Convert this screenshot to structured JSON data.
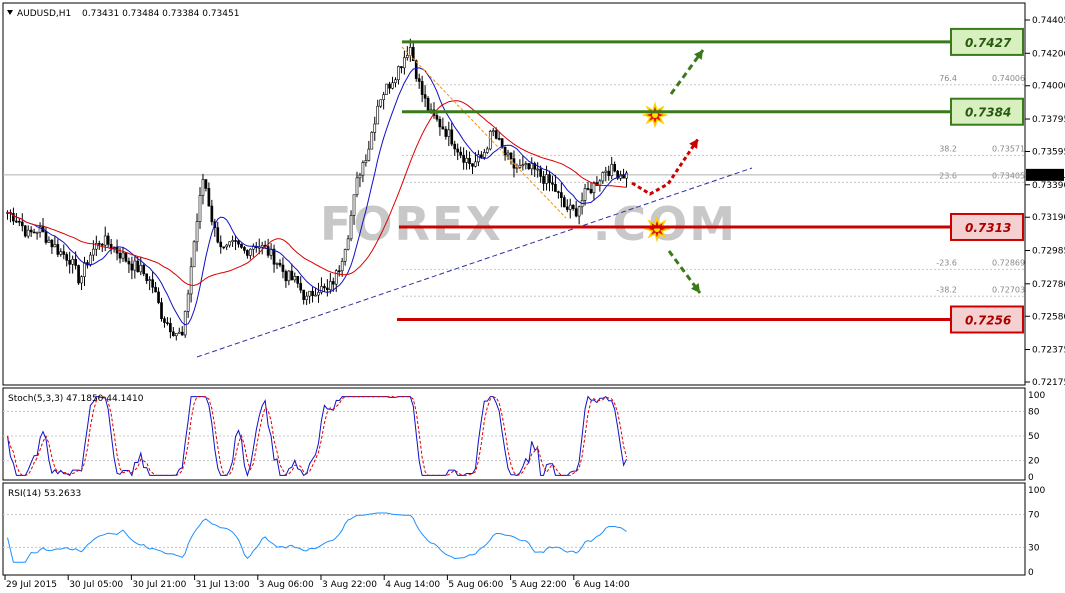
{
  "header": {
    "symbol": "AUDUSD,H1",
    "ohlc": "0.73431 0.73484 0.73384 0.73451"
  },
  "watermark": "FOREX     .COM",
  "price_axis": {
    "ticks": [
      "0.74405",
      "0.74200",
      "0.74000",
      "0.73795",
      "0.73595",
      "0.73390",
      "0.73190",
      "0.72985",
      "0.72780",
      "0.72580",
      "0.72375",
      "0.72175"
    ],
    "current_price": "0.73451"
  },
  "levels": [
    {
      "label": "0.7427",
      "value": 0.7427,
      "kind": "resistance",
      "color": "#3a7a1a",
      "fill": "#d8f0c0"
    },
    {
      "label": "0.7384",
      "value": 0.7384,
      "kind": "resistance",
      "color": "#3a7a1a",
      "fill": "#d8f0c0"
    },
    {
      "label": "0.7313",
      "value": 0.7313,
      "kind": "support",
      "color": "#cc0000",
      "fill": "#f5d0d0"
    },
    {
      "label": "0.7256",
      "value": 0.7256,
      "kind": "support",
      "color": "#cc0000",
      "fill": "#f5d0d0"
    }
  ],
  "fibo_labels": [
    {
      "text": "76.4",
      "value_text": "0.74006",
      "value": 0.74006
    },
    {
      "text": "38.2",
      "value_text": "0.73571",
      "value": 0.73571
    },
    {
      "text": "23.6",
      "value_text": "0.73405",
      "value": 0.73405
    },
    {
      "text": "-23.6",
      "value_text": "0.72869",
      "value": 0.72869
    },
    {
      "text": "-38.2",
      "value_text": "0.72703",
      "value": 0.72703
    }
  ],
  "stoch": {
    "label": "Stoch(5,3,3) 47.1850 44.1410",
    "ticks": [
      "100",
      "80",
      "50",
      "20",
      "0"
    ]
  },
  "rsi": {
    "label": "RSI(14) 53.2633",
    "ticks": [
      "100",
      "70",
      "30",
      "0"
    ]
  },
  "time_axis": [
    "29 Jul 2015",
    "30 Jul 05:00",
    "30 Jul 21:00",
    "31 Jul 13:00",
    "3 Aug 06:00",
    "3 Aug 22:00",
    "4 Aug 14:00",
    "5 Aug 06:00",
    "5 Aug 22:00",
    "6 Aug 14:00"
  ],
  "chart_data": {
    "type": "candlestick",
    "title": "AUDUSD,H1",
    "ylim": [
      0.72175,
      0.74405
    ],
    "x": [
      "29 Jul 2015",
      "30 Jul 05:00",
      "30 Jul 21:00",
      "31 Jul 13:00",
      "3 Aug 06:00",
      "3 Aug 22:00",
      "4 Aug 14:00",
      "5 Aug 06:00",
      "5 Aug 22:00",
      "6 Aug 14:00"
    ],
    "close_path": [
      0.7322,
      0.7318,
      0.7308,
      0.7312,
      0.7305,
      0.7298,
      0.7294,
      0.728,
      0.7296,
      0.7305,
      0.7302,
      0.7296,
      0.729,
      0.7286,
      0.7278,
      0.7258,
      0.725,
      0.7245,
      0.73,
      0.7345,
      0.7312,
      0.7298,
      0.7302,
      0.7298,
      0.7303,
      0.7299,
      0.7293,
      0.7283,
      0.7279,
      0.7268,
      0.7276,
      0.7273,
      0.7285,
      0.7309,
      0.7345,
      0.7362,
      0.7392,
      0.7401,
      0.7412,
      0.7425,
      0.7398,
      0.7382,
      0.7376,
      0.7368,
      0.7358,
      0.7351,
      0.7356,
      0.7372,
      0.736,
      0.735,
      0.7349,
      0.7348,
      0.7343,
      0.7337,
      0.7325,
      0.7322,
      0.7333,
      0.734,
      0.7349,
      0.7347,
      0.7345
    ],
    "levels": [
      0.7427,
      0.7384,
      0.7313,
      0.7256
    ],
    "stoch_last": [
      47.185,
      44.141
    ],
    "rsi_last": 53.2633
  },
  "colors": {
    "candle": "#000000",
    "ma_fast": "#1010c8",
    "ma_slow": "#dd0000",
    "stoch_main": "#1010c8",
    "stoch_signal": "#dd0000",
    "rsi": "#1e90ff",
    "fibo": "#ff8c00",
    "trendline": "#3030a0",
    "grid": "#c8c8c8",
    "up_arrow": "#3a7a1a",
    "down_arrow": "#cc0000"
  }
}
